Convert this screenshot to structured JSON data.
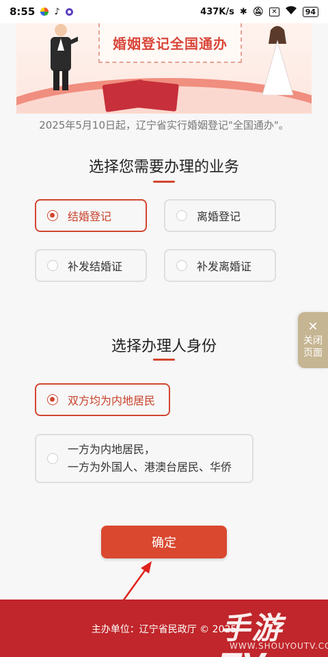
{
  "status_bar": {
    "time": "8:55",
    "network_speed": "437K/s",
    "battery": "94"
  },
  "banner": {
    "title": "婚姻登记全国通办"
  },
  "notice": "2025年5月10日起，辽宁省实行婚姻登记\"全国通办\"。",
  "business_section": {
    "title": "选择您需要办理的业务",
    "options": [
      {
        "label": "结婚登记",
        "selected": true
      },
      {
        "label": "离婚登记",
        "selected": false
      },
      {
        "label": "补发结婚证",
        "selected": false
      },
      {
        "label": "补发离婚证",
        "selected": false
      }
    ]
  },
  "identity_section": {
    "title": "选择办理人身份",
    "options": [
      {
        "label": "双方均为内地居民",
        "selected": true
      },
      {
        "line1": "一方为内地居民，",
        "line2": "一方为外国人、港澳台居民、华侨",
        "selected": false
      }
    ]
  },
  "close_tab": {
    "line1": "关闭",
    "line2": "页面"
  },
  "confirm_label": "确定",
  "footer": {
    "text": "主办单位：辽宁省民政厅 © 2025",
    "watermark": "手游TV",
    "watermark_url": "WWW.SHOUYOUTV.COM"
  },
  "colors": {
    "accent": "#d2462f",
    "footer_bg": "#c0262b",
    "close_tab_bg": "#c6b592"
  }
}
